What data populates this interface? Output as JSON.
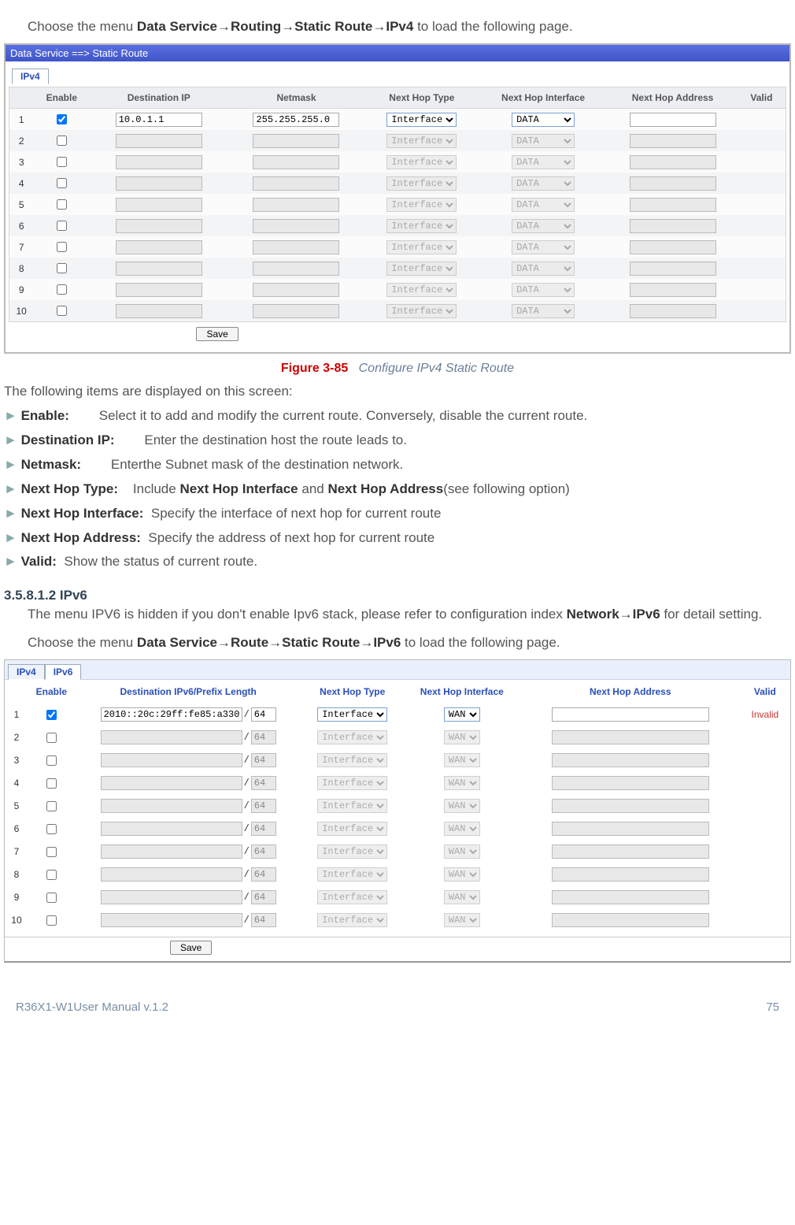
{
  "intro1_pre": "Choose the menu ",
  "intro1_path": "Data Service→Routing→Static Route→IPv4",
  "intro1_post": " to load the following page.",
  "shot1": {
    "titlebar": "Data Service ==> Static Route",
    "tab": "IPv4",
    "headers": {
      "enable": "Enable",
      "dest": "Destination IP",
      "mask": "Netmask",
      "hoptype": "Next Hop Type",
      "hopif": "Next Hop Interface",
      "hopaddr": "Next Hop Address",
      "valid": "Valid"
    },
    "hopTypeOption": "Interface",
    "hopIfOption": "DATA",
    "rows": [
      {
        "n": "1",
        "en": true,
        "dest": "10.0.1.1",
        "mask": "255.255.255.0",
        "hopaddr": ""
      },
      {
        "n": "2",
        "en": false,
        "dest": "",
        "mask": "",
        "hopaddr": ""
      },
      {
        "n": "3",
        "en": false,
        "dest": "",
        "mask": "",
        "hopaddr": ""
      },
      {
        "n": "4",
        "en": false,
        "dest": "",
        "mask": "",
        "hopaddr": ""
      },
      {
        "n": "5",
        "en": false,
        "dest": "",
        "mask": "",
        "hopaddr": ""
      },
      {
        "n": "6",
        "en": false,
        "dest": "",
        "mask": "",
        "hopaddr": ""
      },
      {
        "n": "7",
        "en": false,
        "dest": "",
        "mask": "",
        "hopaddr": ""
      },
      {
        "n": "8",
        "en": false,
        "dest": "",
        "mask": "",
        "hopaddr": ""
      },
      {
        "n": "9",
        "en": false,
        "dest": "",
        "mask": "",
        "hopaddr": ""
      },
      {
        "n": "10",
        "en": false,
        "dest": "",
        "mask": "",
        "hopaddr": ""
      }
    ],
    "save": "Save"
  },
  "caption1": {
    "fig": "Figure 3-85",
    "txt": "Configure IPv4 Static Route"
  },
  "descIntro": "The following items are displayed on this screen:",
  "descs": [
    {
      "label": "Enable:",
      "text": "Select it to add and modify the current route. Conversely, disable the current route."
    },
    {
      "label": "Destination IP:",
      "text": "Enter the destination host the route leads to."
    },
    {
      "label": "Netmask:",
      "text": "Enterthe Subnet mask of the destination network."
    }
  ],
  "descHop": {
    "label": "Next Hop Type:",
    "pre": "Include ",
    "b1": "Next Hop Interface",
    "mid": " and ",
    "b2": "Next Hop Address",
    "post": "(see following option)"
  },
  "descs2": [
    {
      "label": "Next Hop Interface:",
      "text": "Specify the interface of next hop for current route"
    },
    {
      "label": "Next Hop Address:",
      "text": "Specify the address of next hop for current route"
    },
    {
      "label": "Valid:",
      "text": "Show the status of current route."
    }
  ],
  "sec2head": "3.5.8.1.2    IPv6",
  "sec2p1_pre": "The menu IPV6 is hidden if you don't enable Ipv6 stack, please refer to configuration index ",
  "sec2p1_b": "Network→IPv6",
  "sec2p1_post": " for detail setting.",
  "sec2p2_pre": "Choose the menu ",
  "sec2p2_b": "Data Service→Route→Static Route→IPv6",
  "sec2p2_post": " to load the following page.",
  "shot2": {
    "tabs": {
      "a": "IPv4",
      "b": "IPv6"
    },
    "headers": {
      "enable": "Enable",
      "dest": "Destination IPv6/Prefix Length",
      "hoptype": "Next Hop Type",
      "hopif": "Next Hop Interface",
      "hopaddr": "Next Hop Address",
      "valid": "Valid"
    },
    "hopTypeOption": "Interface",
    "hopIfOption": "WAN",
    "invalid": "Invalid",
    "rows": [
      {
        "n": "1",
        "en": true,
        "ip": "2010::20c:29ff:fe85:a330",
        "len": "64",
        "hopaddr": "",
        "valid": true
      },
      {
        "n": "2",
        "en": false,
        "ip": "",
        "len": "64",
        "hopaddr": ""
      },
      {
        "n": "3",
        "en": false,
        "ip": "",
        "len": "64",
        "hopaddr": ""
      },
      {
        "n": "4",
        "en": false,
        "ip": "",
        "len": "64",
        "hopaddr": ""
      },
      {
        "n": "5",
        "en": false,
        "ip": "",
        "len": "64",
        "hopaddr": ""
      },
      {
        "n": "6",
        "en": false,
        "ip": "",
        "len": "64",
        "hopaddr": ""
      },
      {
        "n": "7",
        "en": false,
        "ip": "",
        "len": "64",
        "hopaddr": ""
      },
      {
        "n": "8",
        "en": false,
        "ip": "",
        "len": "64",
        "hopaddr": ""
      },
      {
        "n": "9",
        "en": false,
        "ip": "",
        "len": "64",
        "hopaddr": ""
      },
      {
        "n": "10",
        "en": false,
        "ip": "",
        "len": "64",
        "hopaddr": ""
      }
    ],
    "save": "Save"
  },
  "footer": {
    "left": "R36X1-W1User Manual v.1.2",
    "right": "75"
  }
}
